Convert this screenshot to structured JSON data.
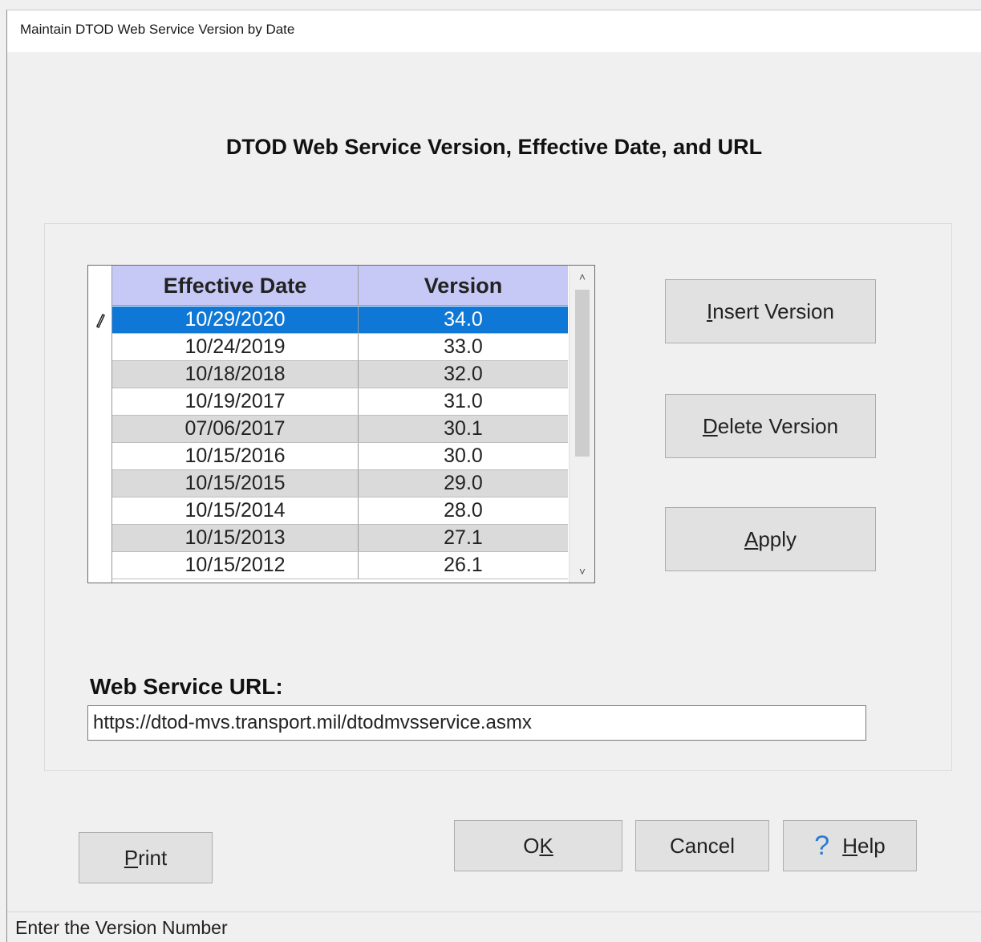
{
  "window": {
    "title": "Maintain DTOD Web Service Version by Date"
  },
  "heading": "DTOD Web Service Version, Effective Date, and URL",
  "grid": {
    "columns": [
      "Effective Date",
      "Version"
    ],
    "rows": [
      {
        "date": "10/29/2020",
        "version": "34.0",
        "selected": true
      },
      {
        "date": "10/24/2019",
        "version": "33.0"
      },
      {
        "date": "10/18/2018",
        "version": "32.0"
      },
      {
        "date": "10/19/2017",
        "version": "31.0"
      },
      {
        "date": "07/06/2017",
        "version": "30.1"
      },
      {
        "date": "10/15/2016",
        "version": "30.0"
      },
      {
        "date": "10/15/2015",
        "version": "29.0"
      },
      {
        "date": "10/15/2014",
        "version": "28.0"
      },
      {
        "date": "10/15/2013",
        "version": "27.1"
      },
      {
        "date": "10/15/2012",
        "version": "26.1"
      }
    ]
  },
  "buttons": {
    "insert": {
      "accel": "I",
      "rest": "nsert Version"
    },
    "delete": {
      "accel": "D",
      "rest": "elete Version"
    },
    "apply": {
      "accel": "A",
      "rest": "pply"
    },
    "print": {
      "accel": "P",
      "rest": "rint"
    },
    "ok": {
      "pre": "O",
      "accel": "K"
    },
    "cancel": "Cancel",
    "help": {
      "icon": "?",
      "accel": "H",
      "rest": "elp"
    }
  },
  "url": {
    "label": "Web Service URL:",
    "value": "https://dtod-mvs.transport.mil/dtodmvsservice.asmx"
  },
  "status": "Enter the Version Number",
  "colors": {
    "header_bg": "#c6c8f6",
    "selected_row": "#0f78d6",
    "alt_row": "#dadada",
    "help_icon": "#2a7bd6"
  }
}
